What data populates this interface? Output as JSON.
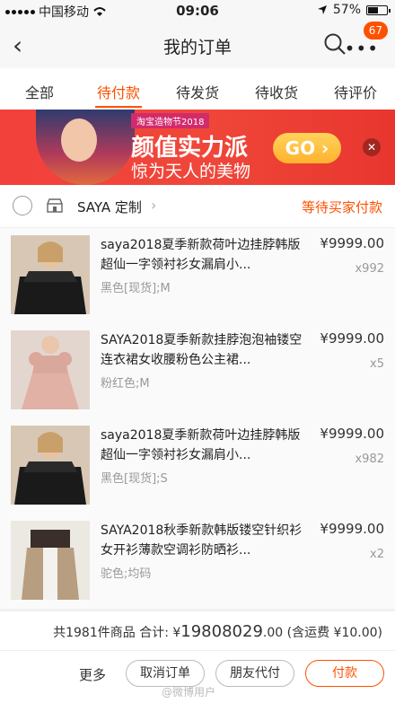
{
  "status_bar": {
    "carrier": "中国移动",
    "time": "09:06",
    "battery": "57%",
    "battery_level": 0.57
  },
  "header": {
    "title": "我的订单",
    "badge": "67"
  },
  "tabs": [
    {
      "label": "全部"
    },
    {
      "label": "待付款"
    },
    {
      "label": "待发货"
    },
    {
      "label": "待收货"
    },
    {
      "label": "待评价"
    }
  ],
  "active_tab": 1,
  "banner": {
    "tag": "淘宝造物节2018",
    "headline": "颜值实力派",
    "subline": "惊为天人的美物",
    "go_label": "GO",
    "close": "✕"
  },
  "shop": {
    "name": "SAYA 定制",
    "status": "等待买家付款"
  },
  "items": [
    {
      "title": "saya2018夏季新款荷叶边挂脖韩版超仙一字领衬衫女漏肩小...",
      "spec": "黑色[现货];M",
      "price": "¥9999.00",
      "qty": "x992"
    },
    {
      "title": "SAYA2018夏季新款挂脖泡泡袖镂空连衣裙女收腰粉色公主裙...",
      "spec": "粉红色;M",
      "price": "¥9999.00",
      "qty": "x5"
    },
    {
      "title": "saya2018夏季新款荷叶边挂脖韩版超仙一字领衬衫女漏肩小...",
      "spec": "黑色[现货];S",
      "price": "¥9999.00",
      "qty": "x982"
    },
    {
      "title": "SAYA2018秋季新款韩版镂空针织衫女开衫薄款空调衫防晒衫...",
      "spec": "驼色;均码",
      "price": "¥9999.00",
      "qty": "x2"
    }
  ],
  "summary": {
    "count_text": "共1981件商品",
    "total_label": "合计: ¥",
    "total_int": "19808029",
    "total_dec": ".00",
    "shipping": "(含运费 ¥10.00)"
  },
  "actions": {
    "more": "更多",
    "cancel": "取消订单",
    "friend_pay": "朋友代付",
    "pay": "付款"
  },
  "watermark": "@微博用户"
}
